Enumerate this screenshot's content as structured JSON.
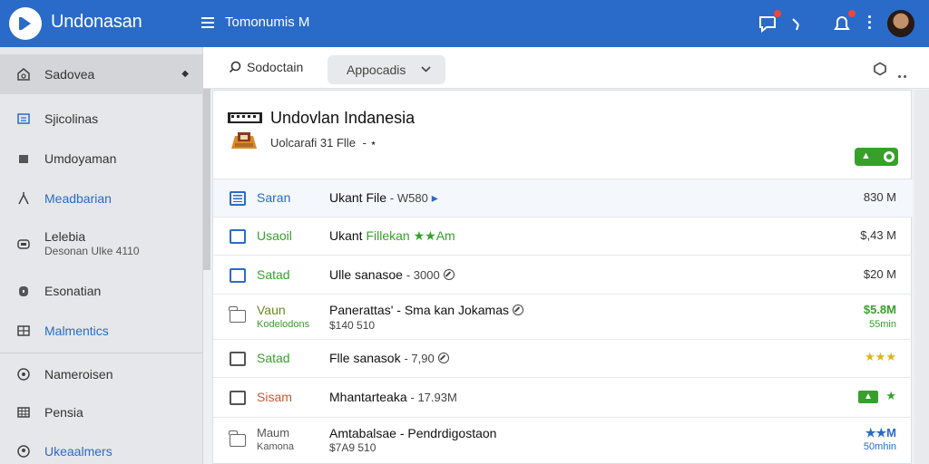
{
  "topbar": {
    "app_title": "Undonasan",
    "tab_label": "Tomonumis M",
    "colors": {
      "primary": "#2a6bc9",
      "badge": "#e8483f"
    },
    "icons": [
      "logo-icon",
      "menu-icon",
      "chat-icon",
      "tools-icon",
      "notification-icon",
      "more-icon",
      "user-avatar"
    ]
  },
  "sidebar": {
    "items": [
      {
        "label": "Sadovea",
        "icon": "home-icon"
      },
      {
        "label": "Sjicolinas",
        "icon": "folder-icon"
      },
      {
        "label": "Umdoyaman",
        "icon": "square-icon"
      },
      {
        "label": "Meadbarian",
        "icon": "tools-icon"
      },
      {
        "label": "Lelebia",
        "sub": "Desonan Ulke 4110",
        "icon": "drive-icon"
      },
      {
        "label": "Esonatian",
        "icon": "lock-icon"
      },
      {
        "label": "Malmentics",
        "icon": "grid-icon"
      },
      {
        "label": "Nameroisen",
        "icon": "settings-icon"
      },
      {
        "label": "Pensia",
        "icon": "table-icon"
      },
      {
        "label": "Ukeaalmers",
        "icon": "account-icon"
      }
    ]
  },
  "toolbar": {
    "search_label": "Sodoctain",
    "dropdown_label": "Appocadis"
  },
  "header": {
    "title": "Undovlan Indanesia",
    "subtitle": "Uolcarafi 31 Flle"
  },
  "rows": [
    {
      "name": "Saran",
      "file": "Ukant File",
      "meta": "- W580",
      "size": "830 M"
    },
    {
      "name": "Usaoil",
      "file": "Ukant",
      "file_green": "Fillekan ★★Am",
      "size": "$,43 M"
    },
    {
      "name": "Satad",
      "file": "Ulle sanasoe",
      "meta": "- 3000",
      "size": "$20 M"
    },
    {
      "name": "Vaun",
      "name2": "Kodelodons",
      "file": "Panerattas' - Sma kan Jokamas",
      "file2": "$140 510",
      "size": "$5.8M",
      "size2": "55min"
    },
    {
      "name": "Satad",
      "file": "Flle sanasok",
      "meta": "- 7,90",
      "size": "★★★"
    },
    {
      "name": "Sisam",
      "file": "Mhantarteaka",
      "meta": "- 17.93M",
      "size": "★"
    },
    {
      "name": "Maum",
      "name2": "Kamona",
      "file": "Amtabalsae - Pendrdigostaon",
      "file2": "$7A9 510",
      "size": "★★M",
      "size2": "50mhin"
    }
  ]
}
